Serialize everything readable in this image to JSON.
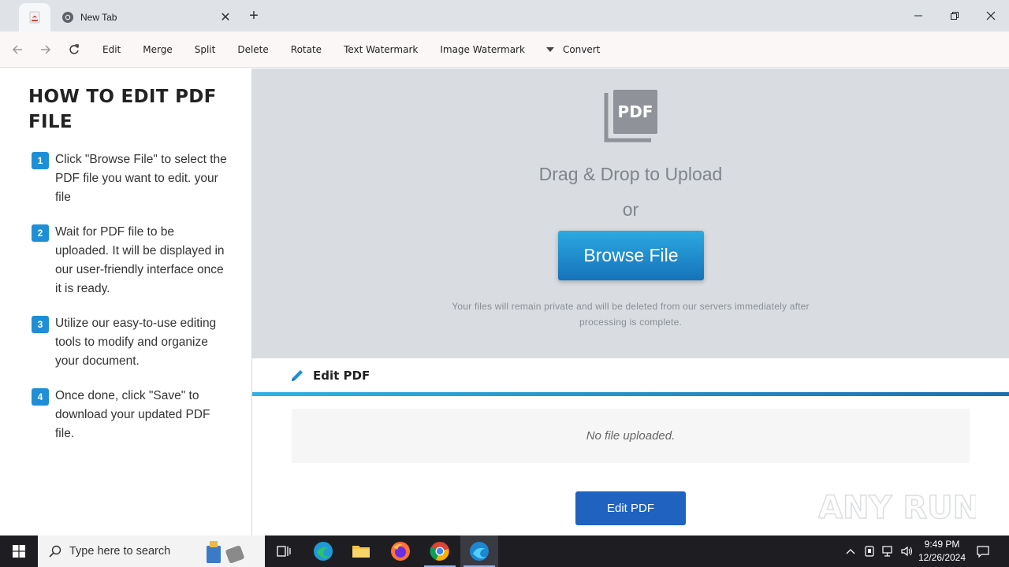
{
  "browser": {
    "tab_title": "New Tab",
    "new_tab_symbol": "+",
    "close_symbol": "✕"
  },
  "toolbar": {
    "items": [
      "Edit",
      "Merge",
      "Split",
      "Delete",
      "Rotate",
      "Text Watermark",
      "Image Watermark"
    ],
    "convert_label": "Convert"
  },
  "sidebar": {
    "title": "HOW TO EDIT PDF FILE",
    "steps": [
      {
        "num": "1",
        "text": "Click \"Browse File\" to select the PDF file you want to edit. your file"
      },
      {
        "num": "2",
        "text": "Wait for PDF file to be uploaded. It will be displayed in our user-friendly interface once it is ready."
      },
      {
        "num": "3",
        "text": "Utilize our easy-to-use editing tools to modify and organize your document."
      },
      {
        "num": "4",
        "text": "Once done, click \"Save\" to download your updated PDF file."
      }
    ]
  },
  "upload": {
    "icon_label": "PDF",
    "drag_text": "Drag & Drop to Upload",
    "or_text": "or",
    "browse_label": "Browse File",
    "privacy_text": "Your files will remain private and will be deleted from our servers immediately after processing is complete."
  },
  "panel": {
    "title": "Edit PDF",
    "empty_text": "No file uploaded.",
    "button_label": "Edit PDF"
  },
  "watermark_text": "ANY RUN",
  "taskbar": {
    "search_placeholder": "Type here to search",
    "time": "9:49 PM",
    "date": "12/26/2024"
  },
  "colors": {
    "accent": "#1e8fd6",
    "browse_button": "#1573ba",
    "edit_button": "#1f62c0",
    "upload_bg": "#d9dce0"
  }
}
